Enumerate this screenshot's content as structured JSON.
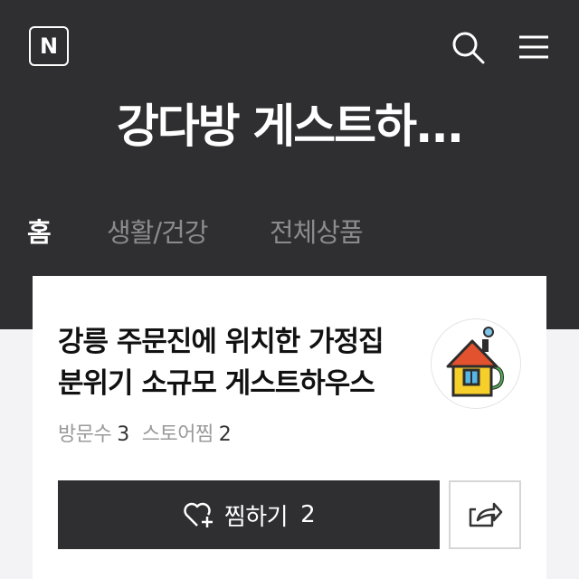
{
  "header": {
    "logo_text": "N",
    "store_title": "강다방 게스트하...",
    "search_icon": "search-icon",
    "menu_icon": "hamburger-menu-icon"
  },
  "tabs": [
    {
      "label": "홈",
      "active": true
    },
    {
      "label": "생활/건강",
      "active": false
    },
    {
      "label": "전체상품",
      "active": false
    }
  ],
  "store_card": {
    "description": "강릉 주문진에 위치한 가정집 분위기 소규모 게스트하우스",
    "avatar_icon": "house-mug-icon",
    "stats": {
      "visits_label": "방문수",
      "visits_value": "3",
      "favorites_label": "스토어찜",
      "favorites_value": "2"
    },
    "like_button": {
      "label": "찜하기",
      "count": "2",
      "icon": "heart-plus-icon"
    },
    "share_button": {
      "icon": "share-icon"
    }
  },
  "colors": {
    "header_bg": "#2f2f31",
    "tab_inactive": "#8b8b8e",
    "page_bg": "#f3f3f5"
  }
}
